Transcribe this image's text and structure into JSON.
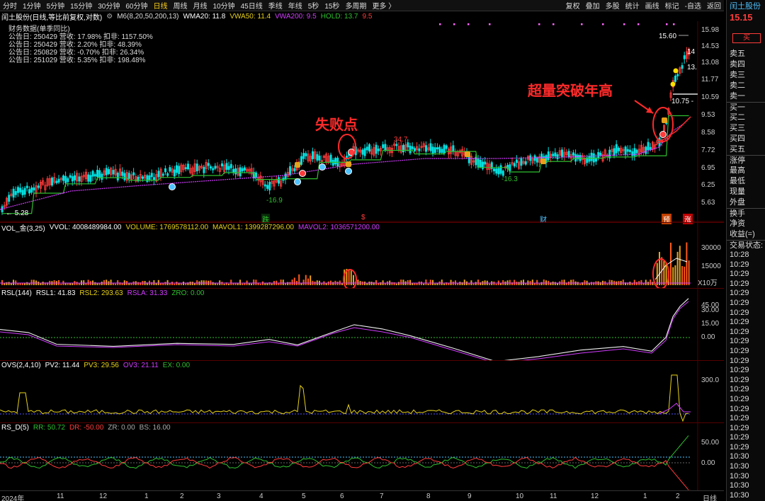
{
  "toolbar": {
    "periods": [
      "分时",
      "1分钟",
      "5分钟",
      "15分钟",
      "30分钟",
      "60分钟",
      "日线",
      "周线",
      "月线",
      "10分钟",
      "45日线",
      "季线",
      "年线",
      "5秒",
      "15秒",
      "多周期",
      "更多 〉"
    ],
    "active": "日线",
    "right": [
      "复权",
      "叠加",
      "多股",
      "统计",
      "画线",
      "标记",
      "-自选",
      "返回"
    ]
  },
  "title": {
    "stock": "闰土股份(日线,等比前复权,对数)",
    "m6": "M6(8,20,50,200,13)",
    "wma20": "WMA20: 11.8",
    "vwa50": "VWA50: 11.4",
    "vwa200": "VWA200: 9.5",
    "hold": "HOLD: 13.7",
    "hold2": "9.5"
  },
  "financial": {
    "header": "财务数据(单季同比)",
    "rows": [
      "公告日: 250429  营收: 17.98%  扣非: 1157.50%",
      "公告日: 250429  营收: 2.20%   扣非: 48.39%",
      "公告日: 250829  营收: -0.70%  扣非: 26.34%",
      "公告日: 251029  营收: 5.35%   扣非: 198.48%"
    ]
  },
  "annotations": {
    "fail": "失败点",
    "breakout": "超量突破年高"
  },
  "price_labels": {
    "low": "← 5.28",
    "p1": "-16.9",
    "p2": "34.7",
    "p3": "-16.3",
    "high": "15.60",
    "p4": "10.75 -",
    "h14": "14",
    "h13": "13."
  },
  "price_axis": [
    "15.98",
    "14.53",
    "13.08",
    "11.77",
    "10.59",
    "9.53",
    "8.58",
    "7.72",
    "6.95",
    "6.25",
    "5.63"
  ],
  "event_tags": {
    "t1": "跌",
    "t2": "$",
    "t3": "财",
    "t4": "预",
    "t5": "涨"
  },
  "vol": {
    "head": [
      "VOL_金(3,25)",
      "VVOL: 4008489984.00",
      "VOLUME: 1769578112.00",
      "MAVOL1: 1399287296.00",
      "MAVOL2: 1036571200.00"
    ],
    "axis": [
      "30000",
      "15000",
      "X10万"
    ]
  },
  "rsl": {
    "head": [
      "RSL(144)",
      "RSL1: 41.83",
      "RSL2: 293.63",
      "RSLA: 31.33",
      "ZRO: 0.00"
    ],
    "axis": [
      "45.00",
      "30.00",
      "15.00",
      "0.00"
    ]
  },
  "ovs": {
    "head": [
      "OVS(2,4,10)",
      "PV2: 11.44",
      "PV3: 29.56",
      "OV3: 21.11",
      "EX: 0.00"
    ],
    "axis": [
      "300.0"
    ]
  },
  "rsd": {
    "head": [
      "RS_D(5)",
      "RR: 50.72",
      "DR: -50.00",
      "ZR: 0.00",
      "BS: 16.00"
    ],
    "axis": [
      "50.00",
      "0.00"
    ]
  },
  "xaxis": [
    "2024年",
    "11",
    "12",
    "1",
    "2",
    "3",
    "4",
    "5",
    "6",
    "7",
    "8",
    "9",
    "10",
    "11",
    "12",
    "1",
    "2",
    "日线"
  ],
  "side": {
    "name": "闰土股份",
    "price": "15.15",
    "buy": "买",
    "book": [
      "卖五",
      "卖四",
      "卖三",
      "卖二",
      "卖一",
      "买一",
      "买二",
      "买三",
      "买四",
      "买五"
    ],
    "stats": [
      "涨停",
      "最高",
      "最低",
      "现量",
      "外盘"
    ],
    "more": [
      "换手",
      "净资",
      "收益(=)"
    ],
    "status": "交易状态: 进",
    "times": [
      "10:28",
      "10:29",
      "10:29",
      "10:29",
      "10:29",
      "10:29",
      "10:29",
      "10:29",
      "10:29",
      "10:29",
      "10:29",
      "10:29",
      "10:29",
      "10:29",
      "10:29",
      "10:29",
      "10:29",
      "10:29",
      "10:29",
      "10:29",
      "10:29",
      "10:30",
      "10:30",
      "10:30",
      "10:30",
      "10:30"
    ]
  },
  "colors": {
    "up": "#ff3b3b",
    "down": "#00e0e0",
    "ma_green": "#2fbf2f",
    "ma_purple": "#d23cff",
    "line_white": "#f0f0f0",
    "yellow": "#e8d21a",
    "red": "#ff2a2a"
  }
}
